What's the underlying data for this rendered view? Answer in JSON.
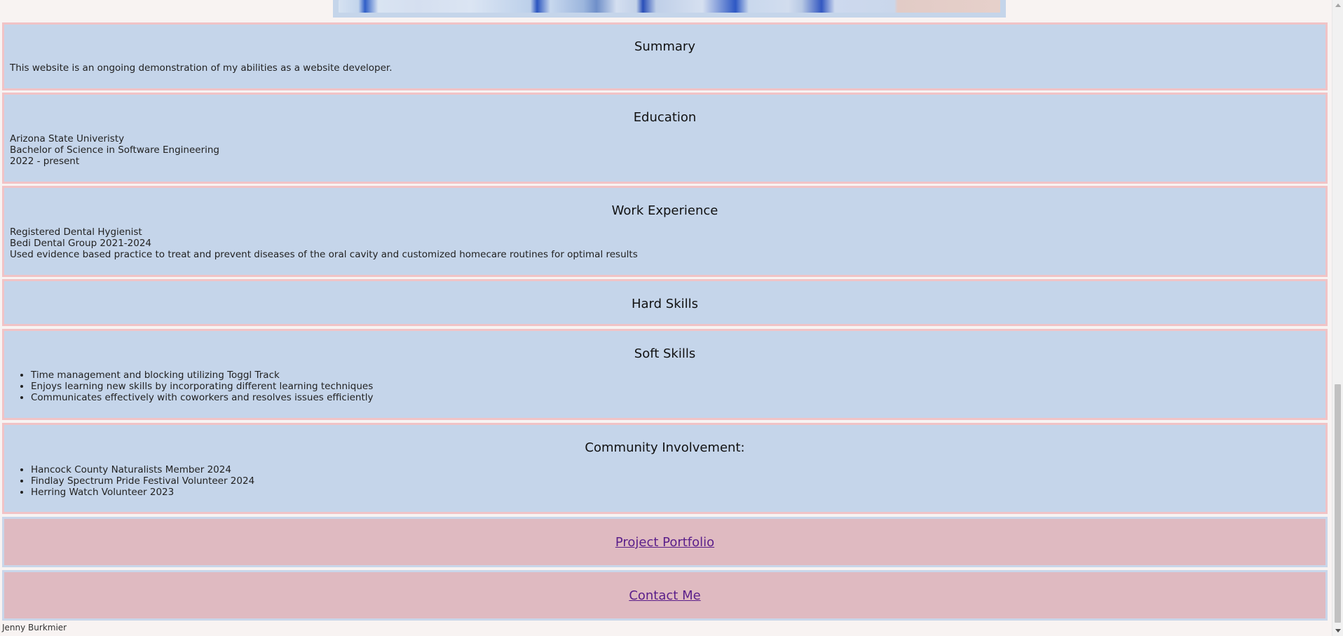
{
  "summary": {
    "heading": "Summary",
    "text": "This website is an ongoing demonstration of my abilities as a website developer."
  },
  "education": {
    "heading": "Education",
    "lines": [
      "Arizona State Univeristy",
      "Bachelor of Science in Software Engineering",
      "2022 - present"
    ]
  },
  "work": {
    "heading": "Work Experience",
    "lines": [
      "Registered Dental Hygienist",
      "Bedi Dental Group 2021-2024",
      "Used evidence based practice to treat and prevent diseases of the oral cavity and customized homecare routines for optimal results"
    ]
  },
  "hard_skills": {
    "heading": "Hard Skills"
  },
  "soft_skills": {
    "heading": "Soft Skills",
    "items": [
      "Time management and blocking utilizing Toggl Track",
      "Enjoys learning new skills by incorporating different learning techniques",
      "Communicates effectively with coworkers and resolves issues efficiently"
    ]
  },
  "community": {
    "heading": "Community Involvement:",
    "items": [
      "Hancock County Naturalists Member 2024",
      "Findlay Spectrum Pride Festival Volunteer 2024",
      "Herring Watch Volunteer 2023"
    ]
  },
  "links": {
    "portfolio": "Project Portfolio",
    "contact": "Contact Me"
  },
  "footer": {
    "name": "Jenny Burkmier"
  },
  "colors": {
    "section_bg": "#c5d5ea",
    "section_border": "#f1c3c6",
    "link_bg": "#dfbac1",
    "link_text": "#5a1e8a",
    "page_bg": "#f8f3f2"
  }
}
